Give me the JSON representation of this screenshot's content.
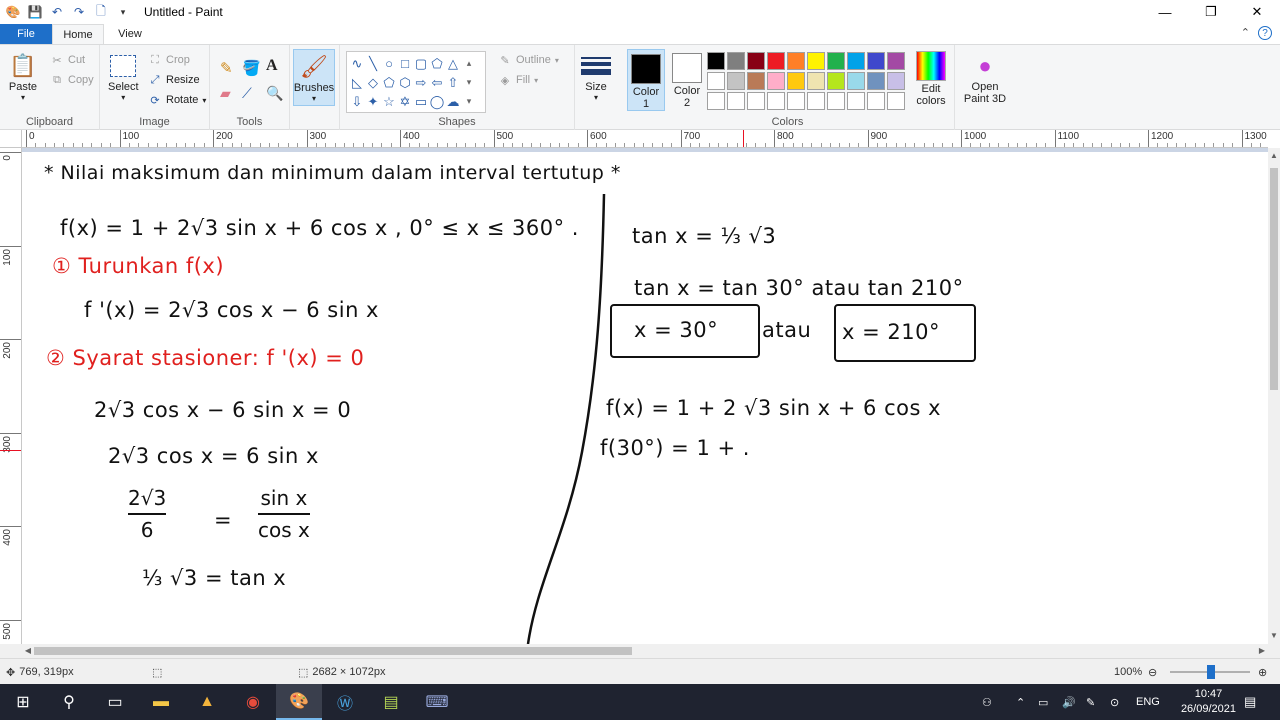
{
  "window": {
    "title": "Untitled - Paint",
    "controls": [
      "minimize-icon",
      "restore-icon",
      "close-icon"
    ]
  },
  "quick_access": [
    "paint-app-icon",
    "save-icon",
    "undo-icon",
    "redo-icon",
    "new-page-icon",
    "customize-dropdown-icon"
  ],
  "tabs": [
    {
      "label": "File"
    },
    {
      "label": "Home"
    },
    {
      "label": "View"
    }
  ],
  "ribbon": {
    "clipboard": {
      "label": "Clipboard",
      "paste": "Paste",
      "cut": "Cut",
      "copy": "Copy"
    },
    "image": {
      "label": "Image",
      "select": "Select",
      "crop": "Crop",
      "resize": "Resize",
      "rotate": "Rotate"
    },
    "tools": {
      "label": "Tools"
    },
    "brushes": {
      "label": "Brushes"
    },
    "shapes": {
      "label": "Shapes",
      "outline": "Outline",
      "fill": "Fill"
    },
    "size": {
      "label": "Size"
    },
    "colors": {
      "label": "Colors",
      "color1": "Color 1",
      "color2": "Color 2",
      "edit_colors": "Edit colors",
      "color1_value": "#000000",
      "color2_value": "#ffffff",
      "palette": [
        "#000000",
        "#7f7f7f",
        "#880015",
        "#ed1c24",
        "#ff7f27",
        "#fff200",
        "#22b14c",
        "#00a2e8",
        "#3f48cc",
        "#a349a4",
        "#ffffff",
        "#c3c3c3",
        "#b97a57",
        "#ffaec9",
        "#ffc90e",
        "#efe4b0",
        "#b5e61d",
        "#99d9ea",
        "#7092be",
        "#c8bfe7",
        "#ffffff",
        "#ffffff",
        "#ffffff",
        "#ffffff",
        "#ffffff",
        "#ffffff",
        "#ffffff",
        "#ffffff",
        "#ffffff",
        "#ffffff"
      ]
    },
    "paint3d": {
      "label": "Open Paint 3D"
    }
  },
  "ruler": {
    "h_ticks": [
      "0",
      "100",
      "200",
      "300",
      "400",
      "500",
      "600",
      "700",
      "800",
      "900",
      "1000",
      "1100",
      "1200",
      "1300"
    ],
    "v_ticks": [
      "0",
      "100",
      "200",
      "300",
      "400",
      "500"
    ]
  },
  "canvas": {
    "heading": "* Nilai maksimum dan minimum dalam interval tertutup *",
    "left": {
      "function": "f(x) = 1 + 2√3 sin x  +  6 cos x  ,  0° ≤ x ≤ 360° .",
      "step1_label": "① Turunkan  f(x)",
      "derivative": "f '(x) = 2√3 cos x − 6 sin x",
      "step2_label": "② Syarat stasioner:  f '(x) = 0",
      "eq1": "2√3 cos x − 6 sin x  =  0",
      "eq2": "2√3 cos x  =  6 sin x",
      "frac_left_num": "2√3",
      "frac_left_den": "6",
      "equals": "=",
      "frac_right_num": "sin x",
      "frac_right_den": "cos x",
      "eq4": "⅓ √3   =   tan x"
    },
    "right": {
      "eq1": "tan x =  ⅓ √3",
      "eq2": "tan x  =  tan 30°  atau  tan 210°",
      "sol1": "x = 30°",
      "atau": "atau",
      "sol2": "x = 210°",
      "eq3": "f(x) =  1 + 2 √3  sin x  + 6  cos x",
      "eq4": "f(30°) =  1 + ."
    }
  },
  "status": {
    "cursor": "769, 319px",
    "dimensions": "2682 × 1072px",
    "zoom": "100%"
  },
  "taskbar": {
    "icons": [
      "windows-start-icon",
      "search-icon",
      "task-view-icon",
      "file-explorer-icon",
      "app-icon",
      "chrome-icon",
      "paint-icon",
      "word-icon",
      "notepad-icon",
      "terminal-icon"
    ],
    "language": "ENG",
    "time": "10:47",
    "date": "26/09/2021"
  }
}
